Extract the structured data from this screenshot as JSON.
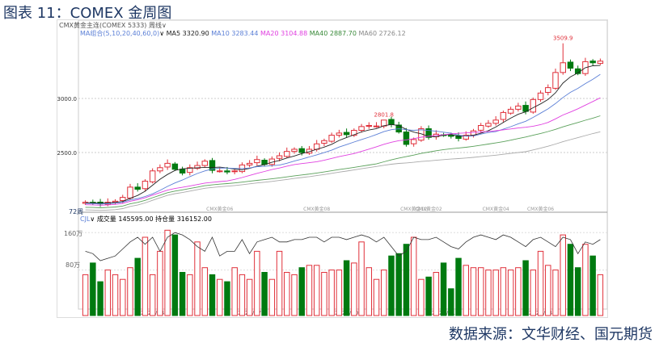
{
  "title": "图表 11：COMEX 金周图",
  "source": "数据来源：文华财经、国元期货",
  "header": {
    "symbol": "CMX黄金主连(COMEX 5333)",
    "period": "周线",
    "ma_group": "MA组合(5,10,20,40,60,0)",
    "ma5": "MA5 3320.90",
    "ma10": "MA10 3283.44",
    "ma20": "MA20 3104.88",
    "ma40": "MA40 2887.70",
    "ma60": "MA60 2726.12"
  },
  "volume_header": {
    "indicator": "CJL",
    "volume": "成交量 145595.00",
    "open_interest": "持仓量 316152.00",
    "scale_top": "160万",
    "scale_mid": "80万",
    "left_tag": "72周"
  },
  "colors": {
    "up": "#e0303a",
    "down": "#007a10",
    "ma5": "#222222",
    "ma10": "#5b7fd6",
    "ma20": "#e040e0",
    "ma40": "#5aa05a",
    "ma60": "#aaaaaa"
  },
  "chart_data": {
    "type": "candlestick",
    "y_ticks": [
      2500,
      3000
    ],
    "ylim": [
      1950,
      3560
    ],
    "x_labels": [
      {
        "index": 9,
        "label": "2024/04"
      },
      {
        "index": 22,
        "label": "2024/07"
      },
      {
        "index": 35,
        "label": "2024/10"
      },
      {
        "index": 48,
        "label": "2025/01"
      },
      {
        "index": 61,
        "label": "2025/04"
      }
    ],
    "contract_labels": [
      {
        "index": 18,
        "label": "CMX黄金06"
      },
      {
        "index": 31,
        "label": "CMX黄金08"
      },
      {
        "index": 44,
        "label": "CMX黄金12"
      },
      {
        "index": 46,
        "label": "CMX黄金02"
      },
      {
        "index": 55,
        "label": "CMX黄金04"
      },
      {
        "index": 61,
        "label": "CMX黄金06"
      }
    ],
    "close": [
      2040,
      2035,
      2025,
      2040,
      2050,
      2085,
      2180,
      2160,
      2235,
      2330,
      2360,
      2400,
      2345,
      2310,
      2360,
      2380,
      2420,
      2335,
      2330,
      2320,
      2330,
      2385,
      2400,
      2435,
      2390,
      2440,
      2470,
      2510,
      2530,
      2500,
      2530,
      2580,
      2610,
      2660,
      2680,
      2665,
      2705,
      2740,
      2750,
      2745,
      2800,
      2760,
      2690,
      2575,
      2620,
      2720,
      2640,
      2670,
      2660,
      2650,
      2630,
      2660,
      2700,
      2750,
      2770,
      2800,
      2870,
      2900,
      2930,
      2880,
      2990,
      3050,
      3100,
      3240,
      3330,
      3280,
      3230,
      3340,
      3330,
      3345
    ],
    "start_open": 2030,
    "high_marks": [
      {
        "index": 40,
        "value": 2801.8
      },
      {
        "index": 64,
        "value": 3509.9
      }
    ],
    "volume": [
      70,
      95,
      55,
      80,
      70,
      60,
      85,
      105,
      150,
      70,
      120,
      165,
      155,
      75,
      70,
      140,
      85,
      70,
      60,
      55,
      85,
      70,
      60,
      120,
      75,
      60,
      120,
      75,
      70,
      85,
      90,
      90,
      75,
      80,
      80,
      100,
      95,
      140,
      85,
      60,
      80,
      110,
      115,
      135,
      150,
      60,
      65,
      75,
      95,
      40,
      105,
      90,
      85,
      85,
      80,
      80,
      85,
      80,
      85,
      100,
      80,
      120,
      90,
      80,
      155,
      135,
      85,
      135,
      110,
      70
    ],
    "open_interest": [
      120,
      115,
      100,
      105,
      110,
      125,
      140,
      150,
      135,
      150,
      120,
      150,
      160,
      155,
      145,
      130,
      120,
      150,
      110,
      120,
      120,
      145,
      115,
      140,
      145,
      150,
      140,
      140,
      145,
      145,
      150,
      150,
      140,
      150,
      150,
      145,
      150,
      155,
      150,
      140,
      150,
      130,
      110,
      120,
      150,
      145,
      145,
      150,
      140,
      130,
      125,
      140,
      150,
      155,
      150,
      145,
      155,
      150,
      140,
      130,
      145,
      150,
      140,
      130,
      150,
      145,
      115,
      140,
      135,
      145
    ]
  }
}
